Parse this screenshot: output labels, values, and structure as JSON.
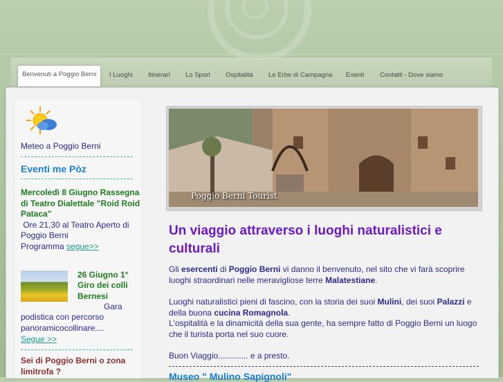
{
  "nav": {
    "items": [
      {
        "label": "Benvenuti a Poggio Berni",
        "active": true
      },
      {
        "label": "I Luoghi"
      },
      {
        "label": "Itinerari"
      },
      {
        "label": "Lo Sport"
      },
      {
        "label": "Ospitalità"
      },
      {
        "label": "Le Erbe di Campagna"
      },
      {
        "label": "Eventi"
      },
      {
        "label": "Contatti - Dove siamo"
      }
    ]
  },
  "sidebar": {
    "weather_icon": "sun-cloud-icon",
    "weather_link": "Meteo a Poggio Berni",
    "events_heading": "Eventi me Pòz",
    "event1": {
      "title_line1": "Mercoledì 8 Giugno  Rassegna",
      "title_line2": "di Teatro Dialettale \"Roid Roid",
      "title_line3": "Pataca\"",
      "body_line1": " Ore 21,30 al Teatro Aperto di",
      "body_line2": "Poggio Berni",
      "body_line3": "Programma",
      "more": "segue>>"
    },
    "event2": {
      "title_line1": "26 Giugno 1°",
      "title_line2": "Giro dei colli",
      "title_line3": "Bernesi",
      "body_line1": "Gara",
      "body_line2": "podistica con percorso",
      "body_line3": "panoramicocollinare....",
      "more": "Segue >>"
    },
    "sub_heading_line1": "Sei di Poggio Berni o zona",
    "sub_heading_line2": "limitrofa ?"
  },
  "main": {
    "photo_caption": "Poggio Berni Tourist",
    "title": "Un viaggio attraverso i luoghi naturalistici e culturali",
    "para1": {
      "t1": "Gli ",
      "b1": "esercenti",
      "t2": " di ",
      "b2": "Poggio Berni",
      "t3": " vi danno il benvenuto, nel sito che vi farà scoprire luoghi straordinari nelle meravigliose terre ",
      "b3": "Malatestiane",
      "t4": "."
    },
    "para2": {
      "t1": "Luoghi naturalistici pieni di fascino, con la storia dei suoi ",
      "b1": "Mulini",
      "t2": ", dei suoi ",
      "b2": "Palazzi",
      "t3": " e della buona ",
      "b3": "cucina Romagnola",
      "t4": "."
    },
    "para3": "L'ospitalità e la dinamicità della sua gente, ha sempre fatto di Poggio Berni un luogo che il turista porta nel suo cuore.",
    "para4": "Buon Viaggio............. e a presto.",
    "next_heading": "Museo \" Mulino Sapignoli\""
  }
}
